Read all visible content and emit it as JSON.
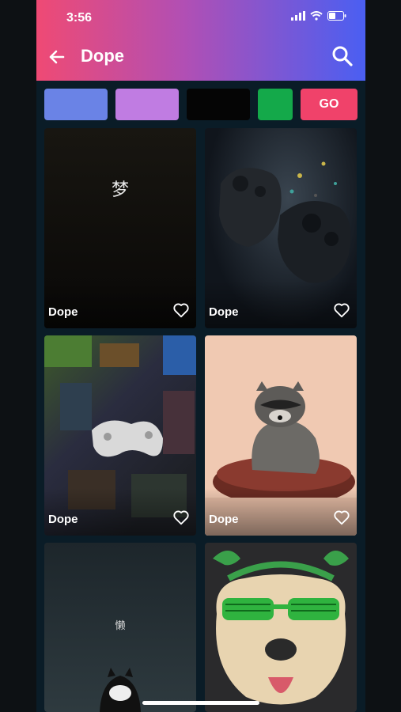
{
  "status_bar": {
    "time": "3:56"
  },
  "header": {
    "title": "Dope"
  },
  "colors": {
    "swatch1": "#6a83e6",
    "swatch2": "#c07ce2",
    "swatch3": "#050505",
    "swatch4": "#14a94a",
    "go_button_bg": "#f0426a"
  },
  "filter": {
    "go_label": "GO"
  },
  "wallpapers": [
    {
      "label": "Dope",
      "icon": "heart-outline-icon",
      "art_text": "梦"
    },
    {
      "label": "Dope",
      "icon": "heart-outline-icon"
    },
    {
      "label": "Dope",
      "icon": "heart-outline-icon"
    },
    {
      "label": "Dope",
      "icon": "heart-outline-icon"
    },
    {
      "label": "",
      "icon": "",
      "art_text": "懒"
    },
    {
      "label": "",
      "icon": ""
    }
  ]
}
